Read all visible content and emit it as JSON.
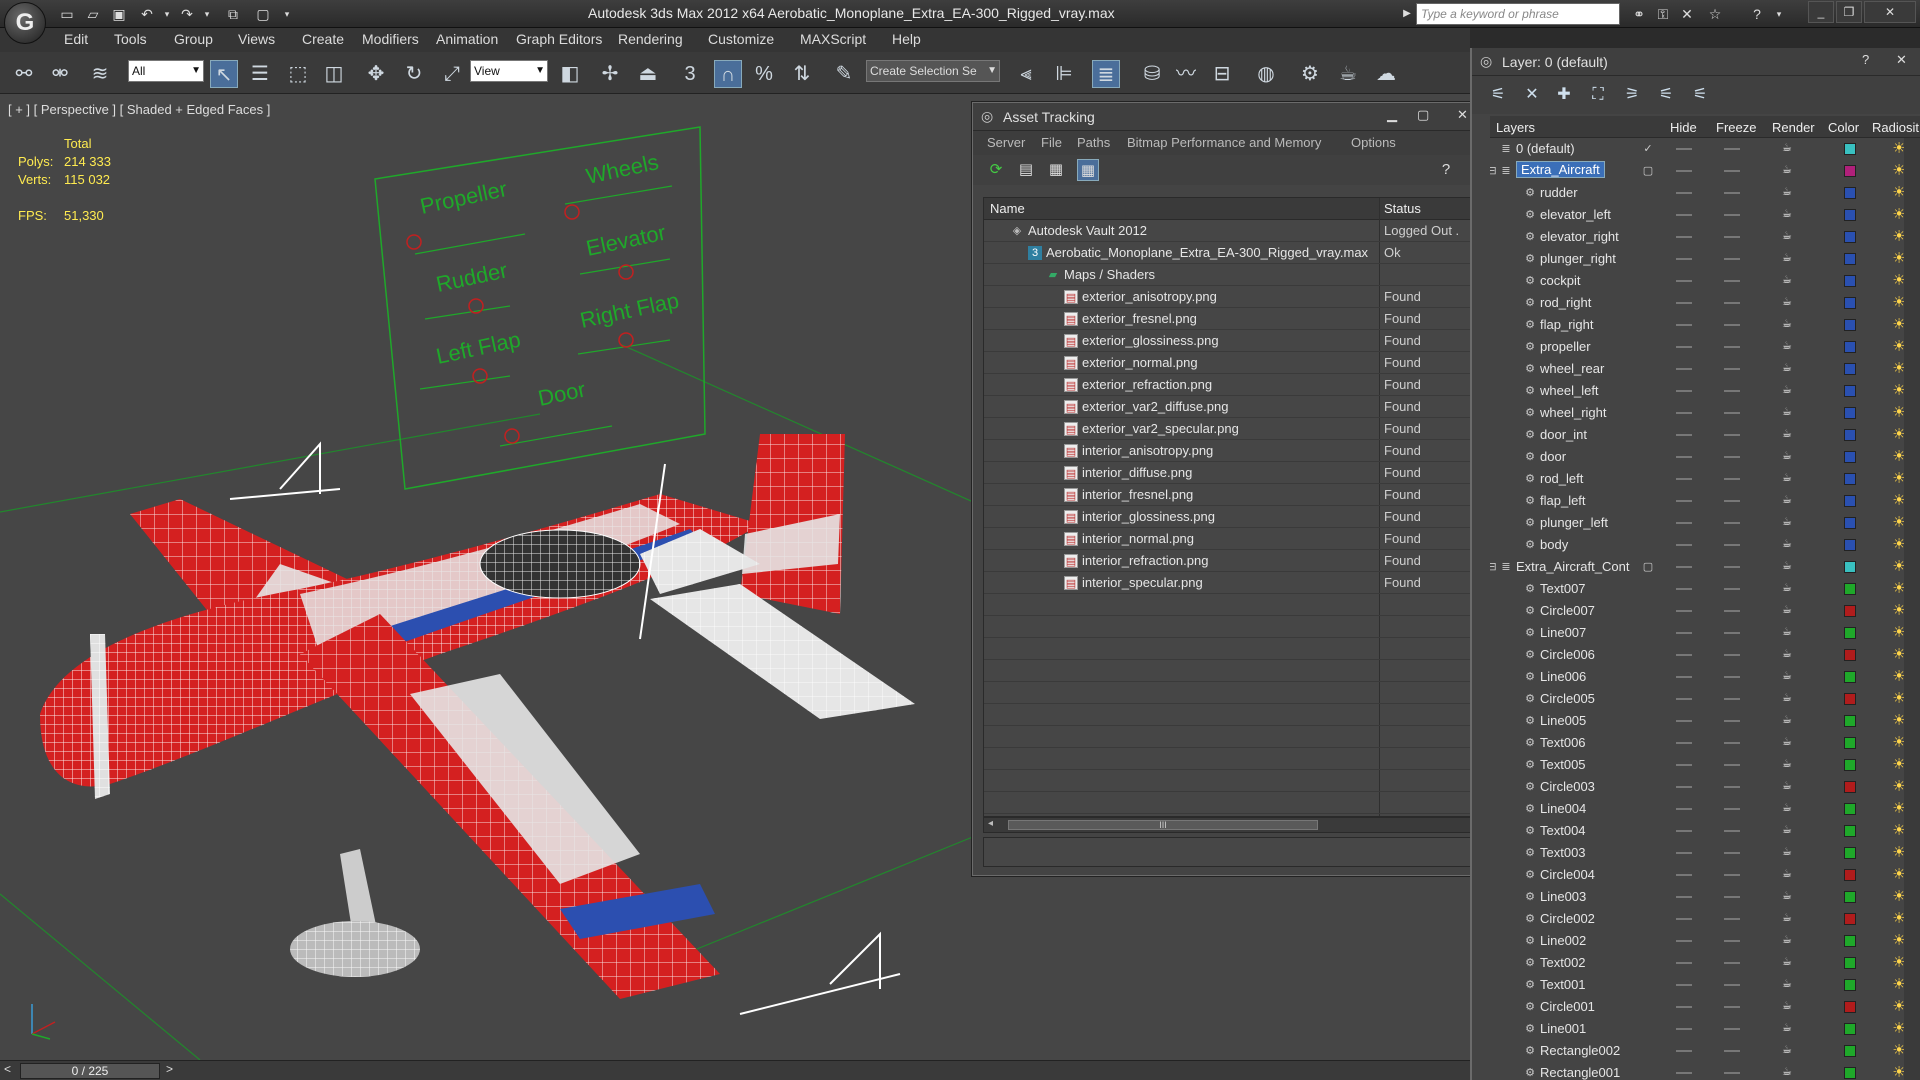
{
  "app": {
    "title": "Autodesk 3ds Max  2012 x64       Aerobatic_Monoplane_Extra_EA-300_Rigged_vray.max",
    "logo_glyph": "G",
    "search_placeholder": "Type a keyword or phrase"
  },
  "menu": [
    "Edit",
    "Tools",
    "Group",
    "Views",
    "Create",
    "Modifiers",
    "Animation",
    "Graph Editors",
    "Rendering",
    "Customize",
    "MAXScript",
    "Help"
  ],
  "toolbar": {
    "filter_value": "All",
    "refcoord_value": "View",
    "selection_set_value": "Create Selection Se"
  },
  "viewport": {
    "label": "[ + ] [ Perspective ] [ Shaded + Edged Faces ]",
    "stats": {
      "total_label": "Total",
      "polys_label": "Polys:",
      "polys_value": "214 333",
      "verts_label": "Verts:",
      "verts_value": "115 032",
      "fps_label": "FPS:",
      "fps_value": "51,330"
    },
    "panel_labels": [
      "Propeller",
      "Wheels",
      "Rudder",
      "Elevator",
      "Left Flap",
      "Right Flap",
      "Door"
    ],
    "timeline": "0 / 225",
    "colors": {
      "bg": "#464646",
      "plane_red": "#d42020",
      "plane_white": "#e6e6e6",
      "plane_blue": "#2c4fb0",
      "ctrl_green": "#1fa82a",
      "ctrl_red": "#c22020"
    }
  },
  "asset_tracking": {
    "title": "Asset Tracking",
    "menu": [
      "Server",
      "File",
      "Paths",
      "Bitmap Performance and Memory",
      "Options"
    ],
    "columns": {
      "name": "Name",
      "status": "Status"
    },
    "rows": [
      {
        "name": "Autodesk Vault 2012",
        "status": "Logged Out .",
        "indent": 1,
        "icon": "vault"
      },
      {
        "name": "Aerobatic_Monoplane_Extra_EA-300_Rigged_vray.max",
        "status": "Ok",
        "indent": 2,
        "icon": "max"
      },
      {
        "name": "Maps / Shaders",
        "status": "",
        "indent": 3,
        "icon": "maps"
      },
      {
        "name": "exterior_anisotropy.png",
        "status": "Found",
        "indent": 4,
        "icon": "file"
      },
      {
        "name": "exterior_fresnel.png",
        "status": "Found",
        "indent": 4,
        "icon": "file"
      },
      {
        "name": "exterior_glossiness.png",
        "status": "Found",
        "indent": 4,
        "icon": "file"
      },
      {
        "name": "exterior_normal.png",
        "status": "Found",
        "indent": 4,
        "icon": "file"
      },
      {
        "name": "exterior_refraction.png",
        "status": "Found",
        "indent": 4,
        "icon": "file"
      },
      {
        "name": "exterior_var2_diffuse.png",
        "status": "Found",
        "indent": 4,
        "icon": "file"
      },
      {
        "name": "exterior_var2_specular.png",
        "status": "Found",
        "indent": 4,
        "icon": "file"
      },
      {
        "name": "interior_anisotropy.png",
        "status": "Found",
        "indent": 4,
        "icon": "file"
      },
      {
        "name": "interior_diffuse.png",
        "status": "Found",
        "indent": 4,
        "icon": "file"
      },
      {
        "name": "interior_fresnel.png",
        "status": "Found",
        "indent": 4,
        "icon": "file"
      },
      {
        "name": "interior_glossiness.png",
        "status": "Found",
        "indent": 4,
        "icon": "file"
      },
      {
        "name": "interior_normal.png",
        "status": "Found",
        "indent": 4,
        "icon": "file"
      },
      {
        "name": "interior_refraction.png",
        "status": "Found",
        "indent": 4,
        "icon": "file"
      },
      {
        "name": "interior_specular.png",
        "status": "Found",
        "indent": 4,
        "icon": "file"
      }
    ],
    "scroll_thumb_glyph": "III"
  },
  "layer_manager": {
    "title": "Layer: 0 (default)",
    "columns": [
      "Layers",
      "Hide",
      "Freeze",
      "Render",
      "Color",
      "Radiosit"
    ],
    "rows": [
      {
        "name": "0 (default)",
        "level": 0,
        "color": "#39c0c0",
        "check": "✓"
      },
      {
        "name": "Extra_Aircraft",
        "level": 0,
        "color": "#b0207a",
        "selected": true,
        "group": true
      },
      {
        "name": "rudder",
        "level": 1,
        "color": "#2a50b0"
      },
      {
        "name": "elevator_left",
        "level": 1,
        "color": "#2a50b0"
      },
      {
        "name": "elevator_right",
        "level": 1,
        "color": "#2a50b0"
      },
      {
        "name": "plunger_right",
        "level": 1,
        "color": "#2a50b0"
      },
      {
        "name": "cockpit",
        "level": 1,
        "color": "#2a50b0"
      },
      {
        "name": "rod_right",
        "level": 1,
        "color": "#2a50b0"
      },
      {
        "name": "flap_right",
        "level": 1,
        "color": "#2a50b0"
      },
      {
        "name": "propeller",
        "level": 1,
        "color": "#2a50b0"
      },
      {
        "name": "wheel_rear",
        "level": 1,
        "color": "#2a50b0"
      },
      {
        "name": "wheel_left",
        "level": 1,
        "color": "#2a50b0"
      },
      {
        "name": "wheel_right",
        "level": 1,
        "color": "#2a50b0"
      },
      {
        "name": "door_int",
        "level": 1,
        "color": "#2a50b0"
      },
      {
        "name": "door",
        "level": 1,
        "color": "#2a50b0"
      },
      {
        "name": "rod_left",
        "level": 1,
        "color": "#2a50b0"
      },
      {
        "name": "flap_left",
        "level": 1,
        "color": "#2a50b0"
      },
      {
        "name": "plunger_left",
        "level": 1,
        "color": "#2a50b0"
      },
      {
        "name": "body",
        "level": 1,
        "color": "#2a50b0"
      },
      {
        "name": "Extra_Aircraft_Cont",
        "level": 0,
        "color": "#39c0c0",
        "group": true
      },
      {
        "name": "Text007",
        "level": 1,
        "color": "#1fa82a"
      },
      {
        "name": "Circle007",
        "level": 1,
        "color": "#b01c1c"
      },
      {
        "name": "Line007",
        "level": 1,
        "color": "#1fa82a"
      },
      {
        "name": "Circle006",
        "level": 1,
        "color": "#b01c1c"
      },
      {
        "name": "Line006",
        "level": 1,
        "color": "#1fa82a"
      },
      {
        "name": "Circle005",
        "level": 1,
        "color": "#b01c1c"
      },
      {
        "name": "Line005",
        "level": 1,
        "color": "#1fa82a"
      },
      {
        "name": "Text006",
        "level": 1,
        "color": "#1fa82a"
      },
      {
        "name": "Text005",
        "level": 1,
        "color": "#1fa82a"
      },
      {
        "name": "Circle003",
        "level": 1,
        "color": "#b01c1c"
      },
      {
        "name": "Line004",
        "level": 1,
        "color": "#1fa82a"
      },
      {
        "name": "Text004",
        "level": 1,
        "color": "#1fa82a"
      },
      {
        "name": "Text003",
        "level": 1,
        "color": "#1fa82a"
      },
      {
        "name": "Circle004",
        "level": 1,
        "color": "#b01c1c"
      },
      {
        "name": "Line003",
        "level": 1,
        "color": "#1fa82a"
      },
      {
        "name": "Circle002",
        "level": 1,
        "color": "#b01c1c"
      },
      {
        "name": "Line002",
        "level": 1,
        "color": "#1fa82a"
      },
      {
        "name": "Text002",
        "level": 1,
        "color": "#1fa82a"
      },
      {
        "name": "Text001",
        "level": 1,
        "color": "#1fa82a"
      },
      {
        "name": "Circle001",
        "level": 1,
        "color": "#b01c1c"
      },
      {
        "name": "Line001",
        "level": 1,
        "color": "#1fa82a"
      },
      {
        "name": "Rectangle002",
        "level": 1,
        "color": "#1fa82a"
      },
      {
        "name": "Rectangle001",
        "level": 1,
        "color": "#1fa82a"
      }
    ]
  }
}
